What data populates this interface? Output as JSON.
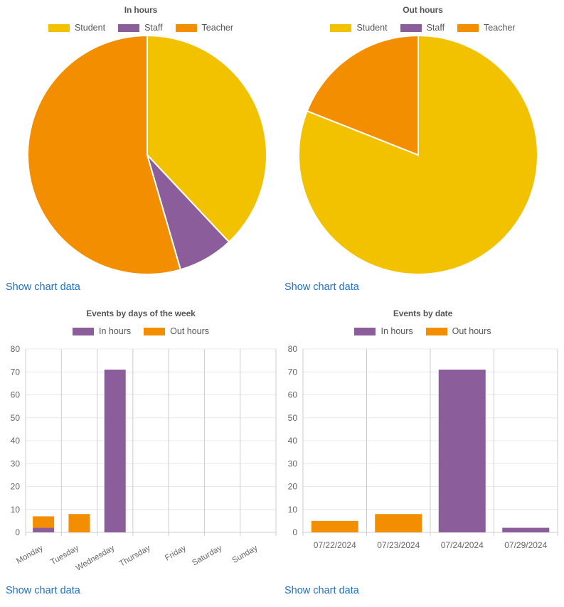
{
  "colors": {
    "student": "#F2C200",
    "staff": "#8B5E9B",
    "teacher": "#F28E00",
    "in_hours": "#8B5E9B",
    "out_hours": "#F28E00",
    "link": "#1f6fc4",
    "text": "#666666",
    "title": "#555555",
    "grid": "#e8e8e8",
    "axis": "#cccccc"
  },
  "panels": {
    "in_hours_pie": {
      "title": "In hours",
      "show_data_link": "Show chart data",
      "legend": [
        {
          "label": "Student",
          "color": "#F2C200"
        },
        {
          "label": "Staff",
          "color": "#8B5E9B"
        },
        {
          "label": "Teacher",
          "color": "#F28E00"
        }
      ]
    },
    "out_hours_pie": {
      "title": "Out hours",
      "show_data_link": "Show chart data",
      "legend": [
        {
          "label": "Student",
          "color": "#F2C200"
        },
        {
          "label": "Staff",
          "color": "#8B5E9B"
        },
        {
          "label": "Teacher",
          "color": "#F28E00"
        }
      ]
    },
    "days_bar": {
      "title": "Events by days of the week",
      "show_data_link": "Show chart data",
      "legend": [
        {
          "label": "In hours",
          "color": "#8B5E9B"
        },
        {
          "label": "Out hours",
          "color": "#F28E00"
        }
      ]
    },
    "date_bar": {
      "title": "Events by date",
      "show_data_link": "Show chart data",
      "legend": [
        {
          "label": "In hours",
          "color": "#8B5E9B"
        },
        {
          "label": "Out hours",
          "color": "#F28E00"
        }
      ]
    }
  },
  "chart_data": [
    {
      "id": "in-hours-pie",
      "type": "pie",
      "title": "In hours",
      "legend_position": "top",
      "labels": [
        "Student",
        "Staff",
        "Teacher"
      ],
      "values": [
        38,
        7.5,
        54.5
      ],
      "unit": "percent",
      "colors": [
        "#F2C200",
        "#8B5E9B",
        "#F28E00"
      ],
      "start_angle_deg": 0
    },
    {
      "id": "out-hours-pie",
      "type": "pie",
      "title": "Out hours",
      "legend_position": "top",
      "labels": [
        "Student",
        "Staff",
        "Teacher"
      ],
      "values": [
        81,
        0,
        19
      ],
      "unit": "percent",
      "colors": [
        "#F2C200",
        "#8B5E9B",
        "#F28E00"
      ],
      "start_angle_deg": 0
    },
    {
      "id": "events-by-days-of-week",
      "type": "bar",
      "stacked": true,
      "title": "Events by days of the week",
      "xlabel": "",
      "ylabel": "",
      "ylim": [
        0,
        80
      ],
      "yticks": [
        0,
        10,
        20,
        30,
        40,
        50,
        60,
        70,
        80
      ],
      "grid": true,
      "legend_position": "top",
      "categories": [
        "Monday",
        "Tuesday",
        "Wednesday",
        "Thursday",
        "Friday",
        "Saturday",
        "Sunday"
      ],
      "series": [
        {
          "name": "In hours",
          "color": "#8B5E9B",
          "values": [
            2,
            0,
            71,
            0,
            0,
            0,
            0
          ]
        },
        {
          "name": "Out hours",
          "color": "#F28E00",
          "values": [
            5,
            8,
            0,
            0,
            0,
            0,
            0
          ]
        }
      ]
    },
    {
      "id": "events-by-date",
      "type": "bar",
      "stacked": true,
      "title": "Events by date",
      "xlabel": "",
      "ylabel": "",
      "ylim": [
        0,
        80
      ],
      "yticks": [
        0,
        10,
        20,
        30,
        40,
        50,
        60,
        70,
        80
      ],
      "grid": true,
      "legend_position": "top",
      "categories": [
        "07/22/2024",
        "07/23/2024",
        "07/24/2024",
        "07/29/2024"
      ],
      "series": [
        {
          "name": "In hours",
          "color": "#8B5E9B",
          "values": [
            0,
            0,
            71,
            2
          ]
        },
        {
          "name": "Out hours",
          "color": "#F28E00",
          "values": [
            5,
            8,
            0,
            0
          ]
        }
      ]
    }
  ]
}
